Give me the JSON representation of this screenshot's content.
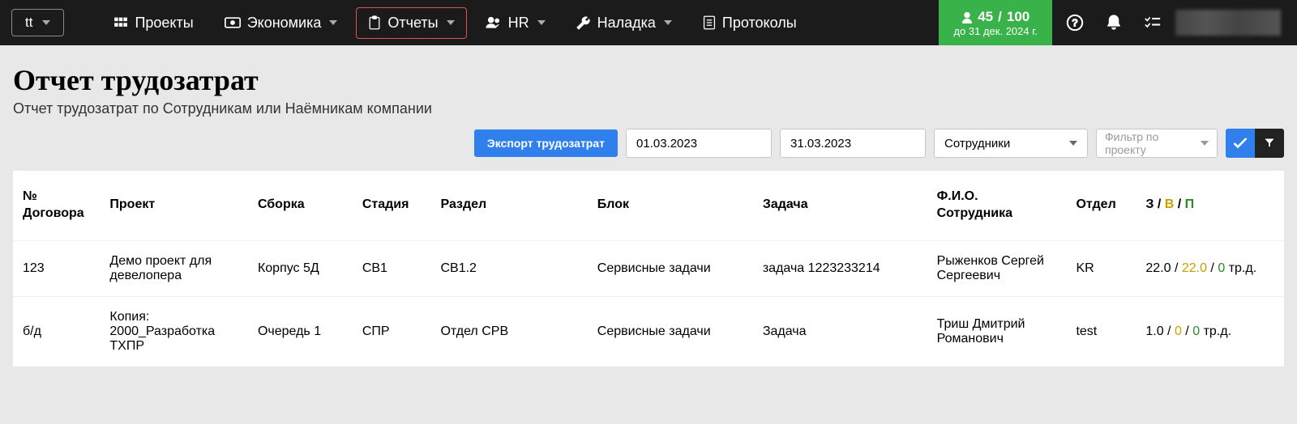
{
  "brand": {
    "label": "tt"
  },
  "nav": {
    "projects": "Проекты",
    "economy": "Экономика",
    "reports": "Отчеты",
    "hr": "HR",
    "tuning": "Наладка",
    "protocols": "Протоколы"
  },
  "counter": {
    "current": "45",
    "max": "100",
    "until": "до 31 дек. 2024 г."
  },
  "page": {
    "title": "Отчет трудозатрат",
    "subtitle": "Отчет трудозатрат по Сотрудникам или Наёмникам компании"
  },
  "toolbar": {
    "export": "Экспорт трудозатрат",
    "date_from": "01.03.2023",
    "date_to": "31.03.2023",
    "subject": "Сотрудники",
    "filter_ph": "Фильтр по проекту"
  },
  "table": {
    "headers": {
      "contract": "№ Договора",
      "project": "Проект",
      "build": "Сборка",
      "stage": "Стадия",
      "section": "Раздел",
      "block": "Блок",
      "task": "Задача",
      "fio": "Ф.И.О. Сотрудника",
      "dept": "Отдел",
      "z": "З",
      "v": "В",
      "p": "П"
    },
    "unit": "тр.д.",
    "rows": [
      {
        "contract": "123",
        "project": "Демо проект для девелопера",
        "build": "Корпус 5Д",
        "stage": "СВ1",
        "section": "СВ1.2",
        "block": "Сервисные задачи",
        "task": "задача 1223233214",
        "fio": "Рыженков Сергей Сергеевич",
        "dept": "KR",
        "z": "22.0",
        "v": "22.0",
        "p": "0"
      },
      {
        "contract": "б/д",
        "project": "Копия: 2000_Разработка ТХПР",
        "build": "Очередь 1",
        "stage": "СПР",
        "section": "Отдел СРВ",
        "block": "Сервисные задачи",
        "task": "Задача",
        "fio": "Триш Дмитрий Романович",
        "dept": "test",
        "z": "1.0",
        "v": "0",
        "p": "0"
      }
    ]
  }
}
